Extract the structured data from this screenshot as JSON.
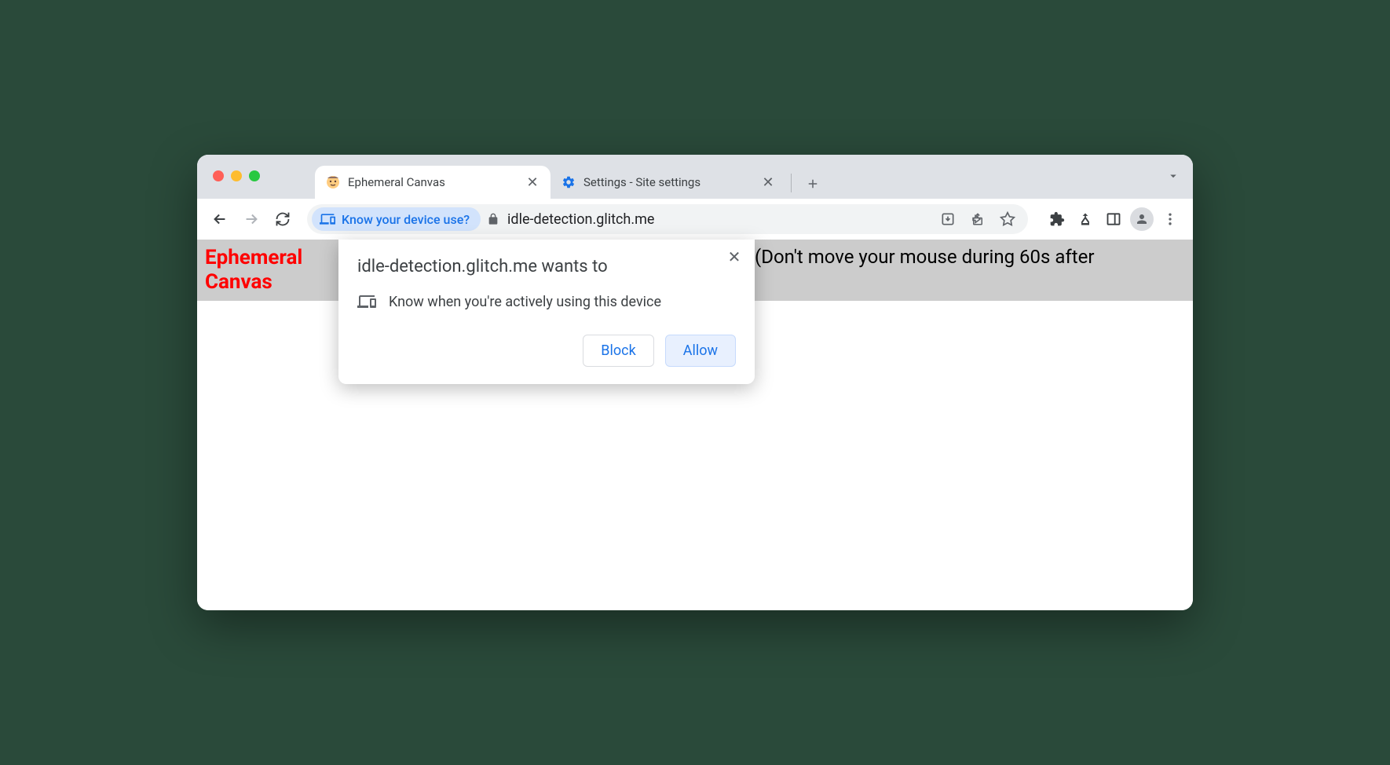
{
  "tabs": [
    {
      "title": "Ephemeral Canvas",
      "favicon": "face-icon"
    },
    {
      "title": "Settings - Site settings",
      "favicon": "gear-icon"
    }
  ],
  "permission_chip": {
    "label": "Know your device use?"
  },
  "url": "idle-detection.glitch.me",
  "page": {
    "title": "Ephemeral Canvas",
    "instruction": "(Don't move your mouse during 60s after"
  },
  "popup": {
    "title": "idle-detection.glitch.me wants to",
    "permission_text": "Know when you're actively using this device",
    "block_label": "Block",
    "allow_label": "Allow"
  }
}
